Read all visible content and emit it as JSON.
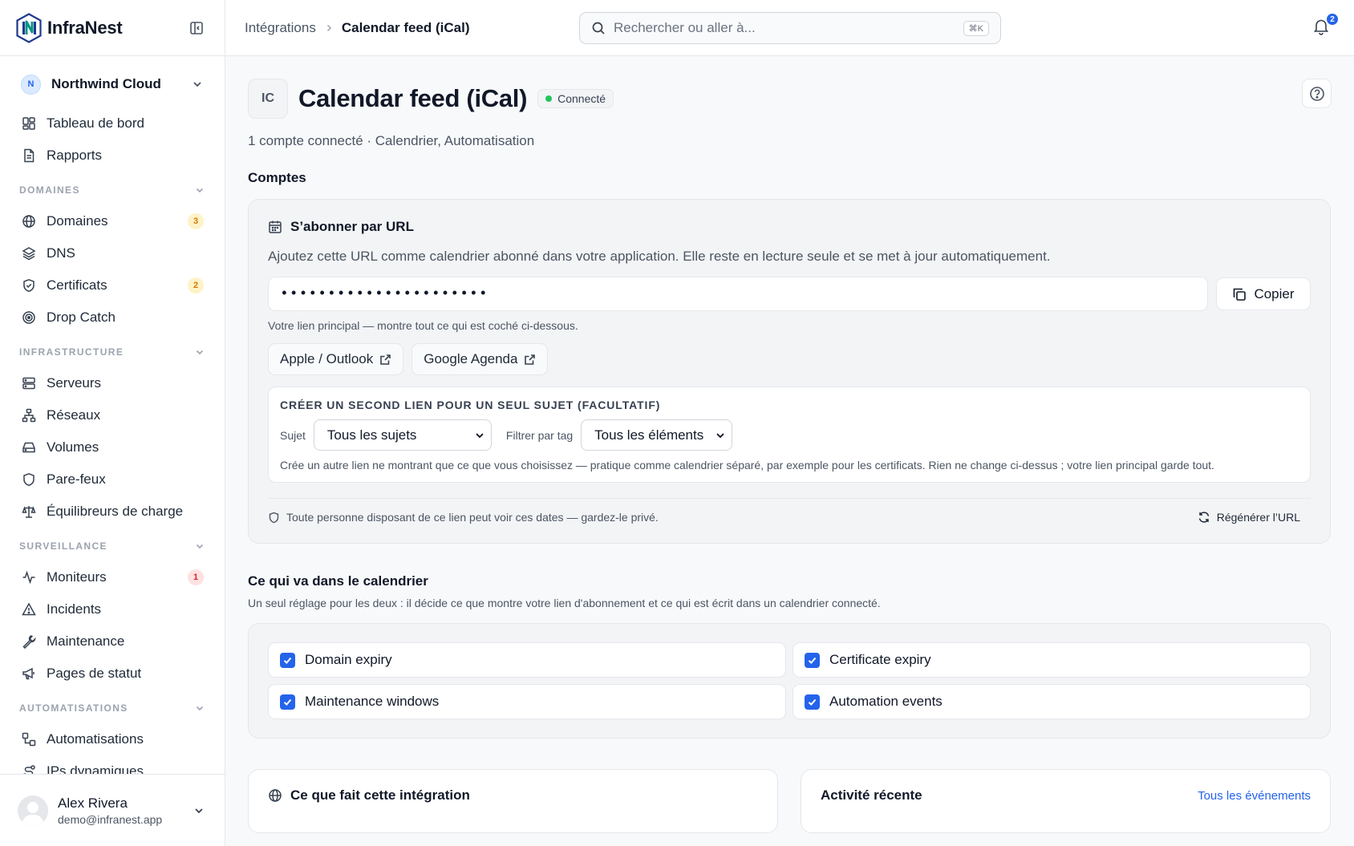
{
  "brand": {
    "name": "InfraNest"
  },
  "org": {
    "initial": "N",
    "name": "Northwind Cloud"
  },
  "nav": {
    "top": [
      {
        "label": "Tableau de bord"
      },
      {
        "label": "Rapports"
      }
    ],
    "sections": [
      {
        "label": "DOMAINES",
        "items": [
          {
            "label": "Domaines",
            "badge": "3"
          },
          {
            "label": "DNS"
          },
          {
            "label": "Certificats",
            "badge": "2"
          },
          {
            "label": "Drop Catch"
          }
        ]
      },
      {
        "label": "INFRASTRUCTURE",
        "items": [
          {
            "label": "Serveurs"
          },
          {
            "label": "Réseaux"
          },
          {
            "label": "Volumes"
          },
          {
            "label": "Pare-feux"
          },
          {
            "label": "Équilibreurs de charge"
          }
        ]
      },
      {
        "label": "SURVEILLANCE",
        "items": [
          {
            "label": "Moniteurs",
            "badge": "1"
          },
          {
            "label": "Incidents"
          },
          {
            "label": "Maintenance"
          },
          {
            "label": "Pages de statut"
          }
        ]
      },
      {
        "label": "AUTOMATISATIONS",
        "items": [
          {
            "label": "Automatisations"
          },
          {
            "label": "IPs dynamiques"
          }
        ]
      }
    ]
  },
  "user": {
    "name": "Alex Rivera",
    "email": "demo@infranest.app"
  },
  "topbar": {
    "breadcrumb_parent": "Intégrations",
    "breadcrumb_current": "Calendar feed (iCal)",
    "search_placeholder": "Rechercher ou aller à...",
    "search_shortcut": "⌘K",
    "notifications_count": "2"
  },
  "header": {
    "logo_text": "IC",
    "title": "Calendar feed (iCal)",
    "status": "Connecté",
    "subtitle": "1 compte connecté · Calendrier, Automatisation"
  },
  "accounts": {
    "heading": "Comptes",
    "card_title": "S’abonner par URL",
    "description": "Ajoutez cette URL comme calendrier abonné dans votre application. Elle reste en lecture seule et se met à jour automatiquement.",
    "masked_url": "••••••••••••••••••••••",
    "copy_label": "Copier",
    "url_hint": "Votre lien principal — montre tout ce qui est coché ci-dessous.",
    "apps": [
      {
        "label": "Apple / Outlook"
      },
      {
        "label": "Google Agenda"
      }
    ],
    "second_link": {
      "title": "CRÉER UN SECOND LIEN POUR UN SEUL SUJET (FACULTATIF)",
      "subject_label": "Sujet",
      "subject_value": "Tous les sujets",
      "tag_label": "Filtrer par tag",
      "tag_value": "Tous les éléments",
      "note": "Crée un autre lien ne montrant que ce que vous choisissez — pratique comme calendrier séparé, par exemple pour les certificats. Rien ne change ci-dessus ; votre lien principal garde tout."
    },
    "privacy_note": "Toute personne disposant de ce lien peut voir ces dates — gardez-le privé.",
    "regenerate_label": "Régénérer l’URL"
  },
  "calendar_contents": {
    "title": "Ce qui va dans le calendrier",
    "subtitle": "Un seul réglage pour les deux : il décide ce que montre votre lien d'abonnement et ce qui est écrit dans un calendrier connecté.",
    "options": [
      {
        "label": "Domain expiry",
        "checked": true
      },
      {
        "label": "Certificate expiry",
        "checked": true
      },
      {
        "label": "Maintenance windows",
        "checked": true
      },
      {
        "label": "Automation events",
        "checked": true
      }
    ]
  },
  "bottom": {
    "what_it_does_title": "Ce que fait cette intégration",
    "activity_title": "Activité récente",
    "all_events_label": "Tous les événements"
  },
  "colors": {
    "accent": "#2563eb",
    "connected": "#22c55e",
    "badge_amber": "#d97706",
    "badge_red": "#dc2626"
  }
}
